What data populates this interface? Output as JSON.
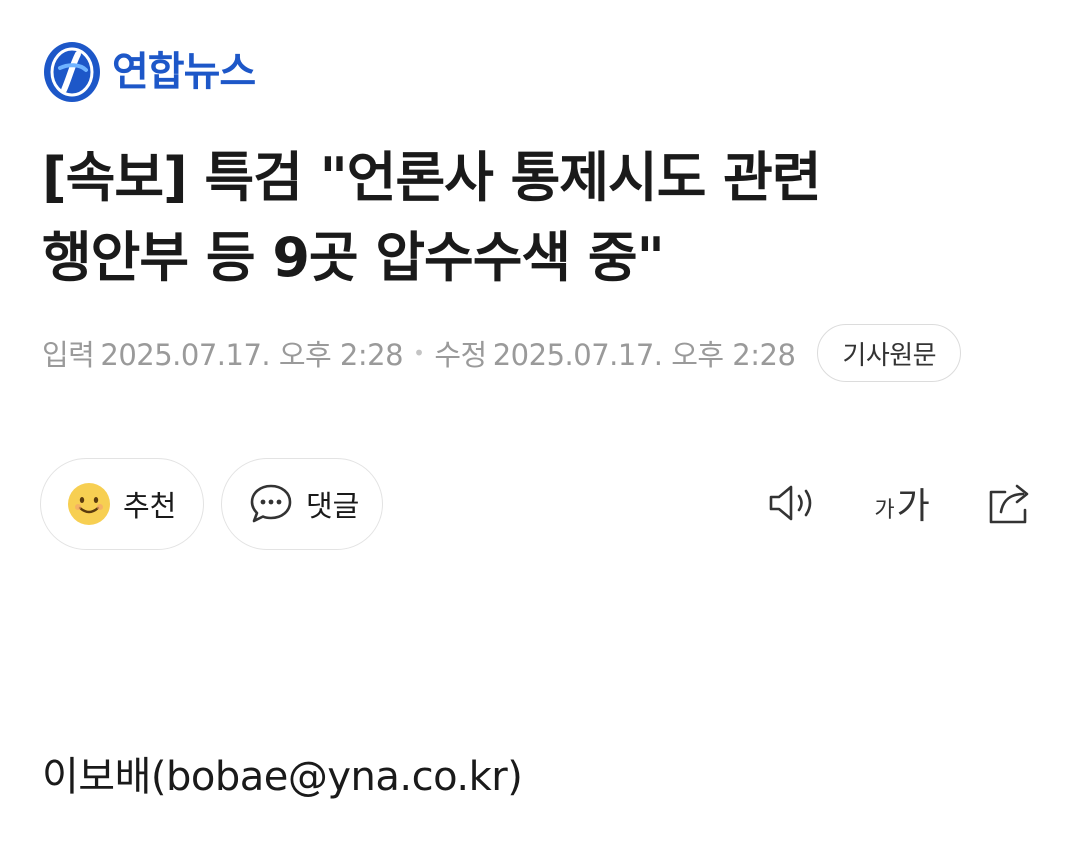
{
  "brand": {
    "name": "연합뉴스",
    "color": "#1d57c8"
  },
  "article": {
    "headline_line1": "[속보] 특검 \"언론사 통제시도 관련",
    "headline_line2": "행안부 등 9곳 압수수색 중\"",
    "input_label": "입력",
    "input_time": "2025.07.17. 오후 2:28",
    "separator": "•",
    "edit_label": "수정",
    "edit_time": "2025.07.17. 오후 2:28",
    "original_button": "기사원문",
    "byline": "이보배(bobae@yna.co.kr)"
  },
  "actions": {
    "recommend_label": "추천",
    "recommend_icon": "smiley-icon",
    "comment_label": "댓글",
    "comment_icon": "speech-bubble-icon"
  },
  "tools": {
    "speak_icon": "speaker-icon",
    "font_small": "가",
    "font_big": "가",
    "share_icon": "share-icon"
  }
}
